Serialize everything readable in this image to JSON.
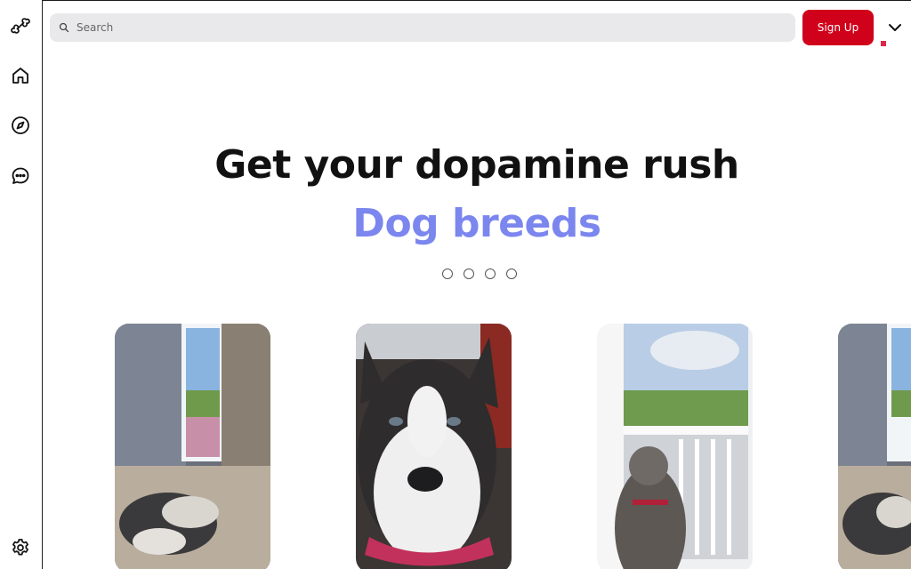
{
  "sidebar": {
    "items": [
      {
        "name": "logo",
        "icon": "bone-icon"
      },
      {
        "name": "home",
        "icon": "home-icon"
      },
      {
        "name": "explore",
        "icon": "compass-icon"
      },
      {
        "name": "messages",
        "icon": "chat-bubble-icon"
      },
      {
        "name": "settings",
        "icon": "gear-icon"
      }
    ]
  },
  "header": {
    "search_placeholder": "Search",
    "signup_label": "Sign Up",
    "menu_icon": "chevron-down-icon",
    "notification_color": "#e0264a"
  },
  "hero": {
    "title": "Get your dopamine rush",
    "subtitle": "Dog breeds",
    "subtitle_color": "#7b86ee",
    "carousel_dots": 4
  },
  "cards": [
    {
      "subject": "husky lying by window with curtains"
    },
    {
      "subject": "husky face close-up with red collar"
    },
    {
      "subject": "husky on balcony looking at hills"
    },
    {
      "subject": "husky lying by window with curtains"
    }
  ],
  "colors": {
    "accent": "#d0021b",
    "search_bg": "#e9e9ec"
  }
}
